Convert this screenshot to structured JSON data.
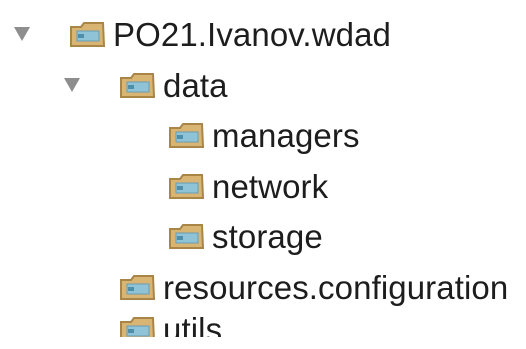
{
  "tree": {
    "root": {
      "label": "PO21.Ivanov.wdad",
      "expanded": true,
      "icon": "package-folder-icon"
    },
    "data": {
      "label": "data",
      "expanded": true,
      "icon": "package-folder-icon"
    },
    "managers": {
      "label": "managers",
      "icon": "package-folder-icon"
    },
    "network": {
      "label": "network",
      "icon": "package-folder-icon"
    },
    "storage": {
      "label": "storage",
      "icon": "package-folder-icon"
    },
    "resources": {
      "label": "resources.configuration",
      "icon": "package-folder-icon"
    },
    "utils": {
      "label": "utils",
      "icon": "package-folder-icon"
    }
  },
  "colors": {
    "folder_fill": "#d9b574",
    "folder_stroke": "#a98548",
    "package_badge": "#8fc4d8",
    "arrow": "#8e8e8e",
    "text": "#1d1d1d"
  }
}
